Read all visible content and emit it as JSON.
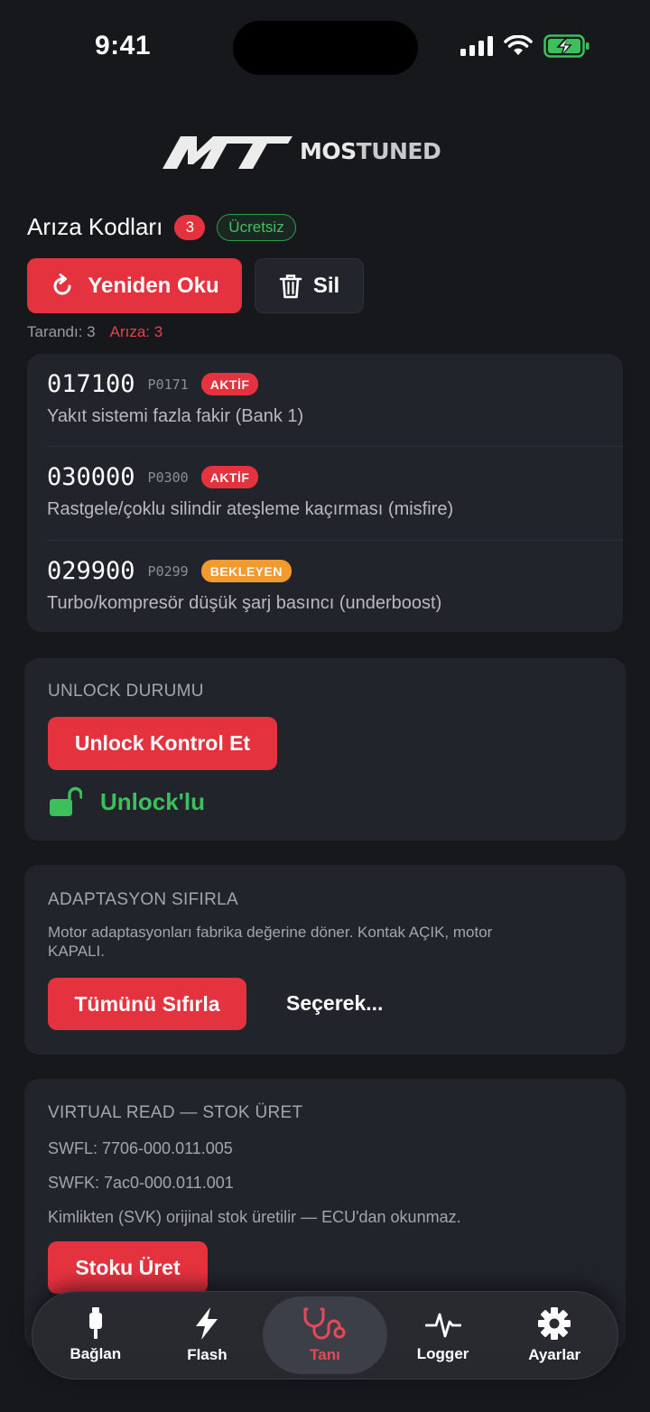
{
  "status_bar": {
    "time": "9:41"
  },
  "logo": {
    "mark": "MT",
    "word_a": "MOS",
    "word_b": "TUNED"
  },
  "faults": {
    "title": "Arıza Kodları",
    "count": "3",
    "free_label": "Ücretsiz",
    "reread_label": "Yeniden Oku",
    "delete_label": "Sil",
    "scanned_label": "Tarandı: 3",
    "fault_label": "Arıza: 3",
    "codes": [
      {
        "code": "017100",
        "pcode": "P0171",
        "status": "AKTİF",
        "desc": "Yakıt sistemi fazla fakir (Bank 1)"
      },
      {
        "code": "030000",
        "pcode": "P0300",
        "status": "AKTİF",
        "desc": "Rastgele/çoklu silindir ateşleme kaçırması (misfire)"
      },
      {
        "code": "029900",
        "pcode": "P0299",
        "status": "BEKLEYEN",
        "desc": "Turbo/kompresör düşük şarj basıncı (underboost)"
      }
    ]
  },
  "unlock": {
    "title": "UNLOCK DURUMU",
    "button": "Unlock Kontrol Et",
    "status": "Unlock'lu"
  },
  "adaptation": {
    "title": "ADAPTASYON SIFIRLA",
    "desc": "Motor adaptasyonları fabrika değerine döner. Kontak AÇIK, motor KAPALI.",
    "reset_button": "Tümünü Sıfırla",
    "select_button": "Seçerek..."
  },
  "virtual_read": {
    "title": "VIRTUAL READ — STOK ÜRET",
    "swfl": "SWFL: 7706-000.011.005",
    "swfk": "SWFK: 7ac0-000.011.001",
    "note": "Kimlikten (SVK) orijinal stok üretilir — ECU'dan okunmaz.",
    "button": "Stoku Üret"
  },
  "tabs": [
    {
      "label": "Bağlan",
      "icon": "usb-connector-icon"
    },
    {
      "label": "Flash",
      "icon": "lightning-icon"
    },
    {
      "label": "Tanı",
      "icon": "stethoscope-icon",
      "active": true
    },
    {
      "label": "Logger",
      "icon": "pulse-icon"
    },
    {
      "label": "Ayarlar",
      "icon": "gear-icon"
    }
  ],
  "colors": {
    "accent": "#e5323f",
    "success": "#3cc05c",
    "warning": "#f39a2f",
    "background": "#17181c",
    "card": "#21242b"
  }
}
